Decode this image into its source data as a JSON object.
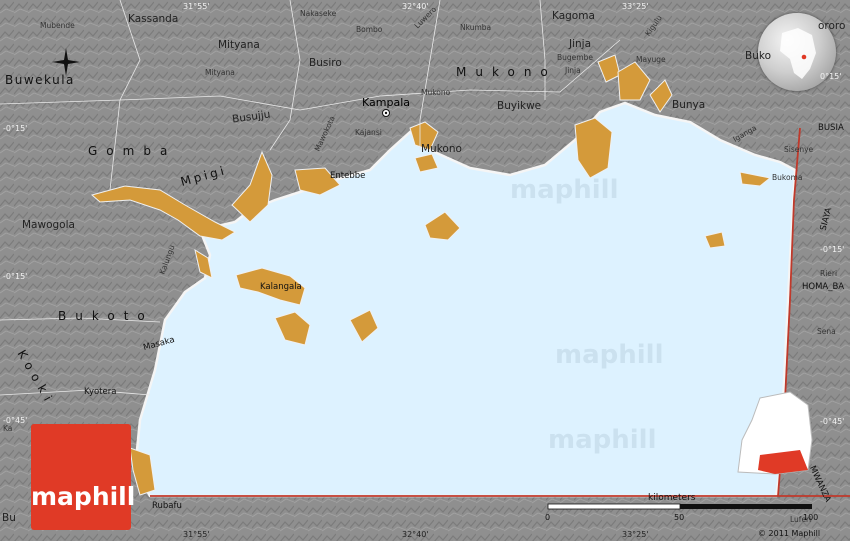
{
  "brand": {
    "logo_text": "maphill",
    "watermark_text": "maphill"
  },
  "scale": {
    "title": "kilometers",
    "ticks": [
      "0",
      "50",
      "100"
    ]
  },
  "copyright": "© 2011 Maphill",
  "coordinates": {
    "top": [
      "31°55'",
      "32°40'",
      "33°25'"
    ],
    "bottom": [
      "31°55'",
      "32°40'",
      "33°25'"
    ],
    "left": [
      "-0°15'",
      "-0°15'",
      "-0°45'"
    ],
    "right": [
      "0°15'",
      "-0°15'",
      "-0°45'"
    ]
  },
  "labels": {
    "mubende": "Mubende",
    "kassanda": "Kassanda",
    "nakaseke": "Nakaseke",
    "bombo": "Bombo",
    "luwero": "Luwero",
    "nkumba": "Nkumba",
    "kagoma": "Kagoma",
    "kigulu": "Kigulu",
    "buko": "Buko",
    "buwekula": "Buwekula",
    "mityana": "Mityana",
    "mityana_town": "Mityana",
    "busiro": "Busiro",
    "mukono_region": "Mukono",
    "mukono_town": "Mukono",
    "mukono_town2": "Mukono",
    "jinja": "Jinja",
    "bugembe": "Bugembe",
    "jinja_town": "Jinja",
    "mayuge_town": "Mayuge",
    "mayuge": "Mayuge",
    "tororo": "ororo",
    "kampala": "Kampala",
    "buyikwe": "Buyikwe",
    "bunya": "Bunya",
    "busujju": "Busujju",
    "mawokota": "Mawokota",
    "kajansi": "Kajansi",
    "iganga": "Iganga",
    "busia": "BUSIA",
    "gomba": "Gomba",
    "mpigi": "Mpigi",
    "entebbe": "Entebbe",
    "sisenye": "Sisenye",
    "bukoma": "Bukoma",
    "siaya": "SIAYA",
    "mawogola": "Mawogola",
    "kalungu": "Kalungu",
    "rieri": "Rieri",
    "homa_bay": "HOMA_BA",
    "kalangala": "Kalangala",
    "bukoto": "Bukoto",
    "masaka": "Masaka",
    "sena": "Sena",
    "kooki": "Kooki",
    "kyotera": "Kyotera",
    "rubafu": "Rubafu",
    "mwanza": "MWANZA",
    "bu": "Bu",
    "luferi": "Luferi",
    "ka": "Ka"
  }
}
